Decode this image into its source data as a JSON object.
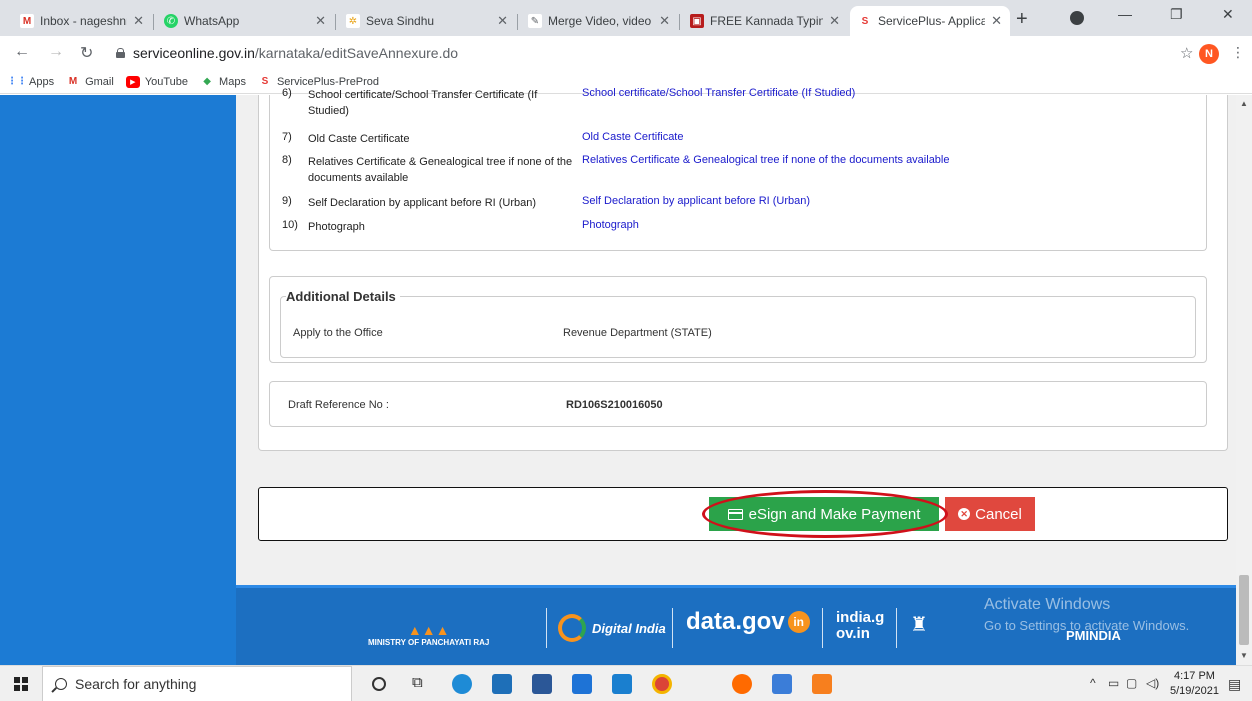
{
  "browser": {
    "tabs": [
      {
        "title": "Inbox - nageshnmedc",
        "icon": "gmail-icon",
        "color": "#d93025"
      },
      {
        "title": "WhatsApp",
        "icon": "whatsapp-icon",
        "color": "#25d366"
      },
      {
        "title": "Seva Sindhu",
        "icon": "seva-sindhu-icon",
        "color": "#e8a317"
      },
      {
        "title": "Merge Video, video jo",
        "icon": "edit-icon",
        "color": "#8ab4f8"
      },
      {
        "title": "FREE Kannada Typing",
        "icon": "keyboard-icon",
        "color": "#b71c1c"
      },
      {
        "title": "ServicePlus- Applicatio",
        "icon": "serviceplus-icon",
        "color": "#e53935"
      }
    ],
    "url_host": "serviceonline.gov.in",
    "url_path": "/karnataka/editSaveAnnexure.do",
    "avatar_letter": "N",
    "bookmarks": [
      {
        "label": "Apps",
        "icon": "apps-grid-icon"
      },
      {
        "label": "Gmail",
        "icon": "gmail-icon"
      },
      {
        "label": "YouTube",
        "icon": "youtube-icon"
      },
      {
        "label": "Maps",
        "icon": "maps-icon"
      },
      {
        "label": "ServicePlus-PreProd",
        "icon": "serviceplus-icon"
      }
    ]
  },
  "documents": [
    {
      "num": "6)",
      "name": "School certificate/School Transfer Certificate (If Studied)",
      "link": "School certificate/School Transfer Certificate (If Studied)"
    },
    {
      "num": "7)",
      "name": "Old Caste Certificate",
      "link": "Old Caste Certificate"
    },
    {
      "num": "8)",
      "name": "Relatives Certificate & Genealogical tree if none of the documents available",
      "link": "Relatives Certificate & Genealogical tree if none of the documents available"
    },
    {
      "num": "9)",
      "name": "Self Declaration by applicant before RI (Urban)",
      "link": "Self Declaration by applicant before RI (Urban)"
    },
    {
      "num": "10)",
      "name": "Photograph",
      "link": "Photograph"
    }
  ],
  "additional": {
    "title": "Additional Details",
    "office_label": "Apply to the Office",
    "office_value": "Revenue Department (STATE)"
  },
  "draft": {
    "label": "Draft Reference No :",
    "value": "RD106S210016050"
  },
  "actions": {
    "esign_label": "eSign and Make Payment",
    "cancel_label": "Cancel"
  },
  "footer": {
    "logos": [
      "MINISTRY OF PANCHAYATI RAJ",
      "Digital India",
      "data.gov",
      "india.gov.in",
      "PMINDIA"
    ],
    "activate_title": "Activate Windows",
    "activate_sub": "Go to Settings to activate Windows."
  },
  "taskbar": {
    "search_placeholder": "Search for anything",
    "time": "4:17 PM",
    "date": "5/19/2021"
  }
}
